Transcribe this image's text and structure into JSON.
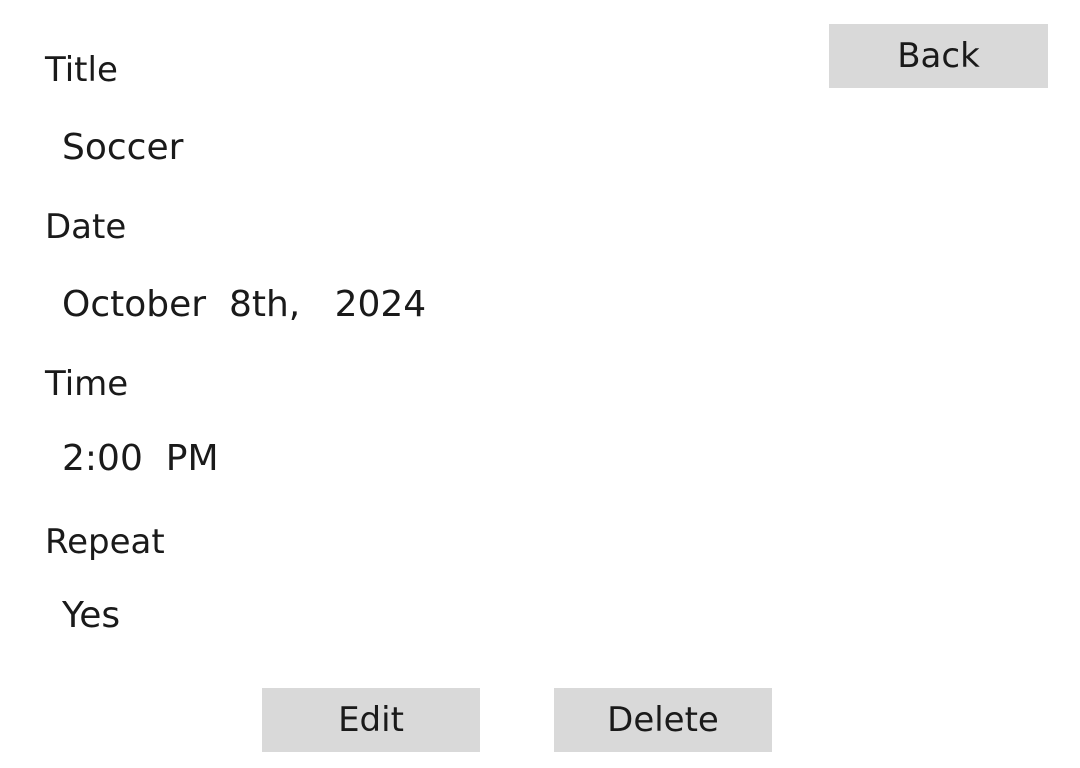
{
  "fields": {
    "title": {
      "label": "Title",
      "value": "Soccer"
    },
    "date": {
      "label": "Date",
      "value": "October  8th,   2024"
    },
    "time": {
      "label": "Time",
      "value": "2:00  PM"
    },
    "repeat": {
      "label": "Repeat",
      "value": "Yes"
    }
  },
  "buttons": {
    "back": "Back",
    "edit": "Edit",
    "delete": "Delete"
  }
}
